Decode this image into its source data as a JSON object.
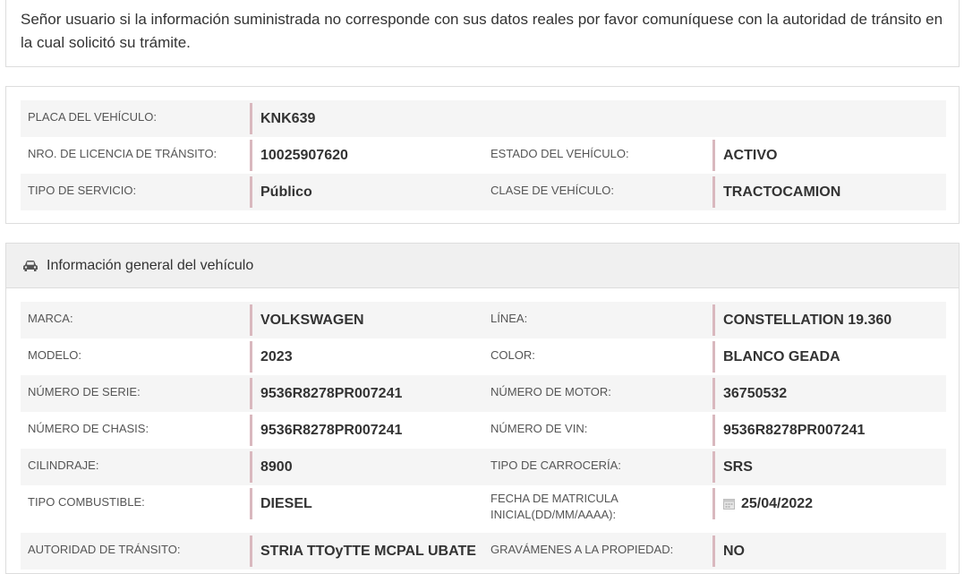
{
  "notice": "Señor usuario si la información suministrada no corresponde con sus datos reales por favor comuníquese con la autoridad de tránsito en la cual solicitó su trámite.",
  "summary": {
    "placa_label": "PLACA DEL VEHÍCULO:",
    "placa_value": "KNK639",
    "licencia_label": "NRO. DE LICENCIA DE TRÁNSITO:",
    "licencia_value": "10025907620",
    "estado_label": "ESTADO DEL VEHÍCULO:",
    "estado_value": "ACTIVO",
    "servicio_label": "TIPO DE SERVICIO:",
    "servicio_value": "Público",
    "clase_label": "CLASE DE VEHÍCULO:",
    "clase_value": "TRACTOCAMION"
  },
  "general": {
    "title": "Información general del vehículo",
    "icon": "car-icon",
    "rows": [
      {
        "l1": "MARCA:",
        "v1": "VOLKSWAGEN",
        "l2": "LÍNEA:",
        "v2": "CONSTELLATION 19.360"
      },
      {
        "l1": "MODELO:",
        "v1": "2023",
        "l2": "COLOR:",
        "v2": "BLANCO GEADA"
      },
      {
        "l1": "NÚMERO DE SERIE:",
        "v1": "9536R8278PR007241",
        "l2": "NÚMERO DE MOTOR:",
        "v2": "36750532"
      },
      {
        "l1": "NÚMERO DE CHASIS:",
        "v1": "9536R8278PR007241",
        "l2": "NÚMERO DE VIN:",
        "v2": "9536R8278PR007241"
      },
      {
        "l1": "CILINDRAJE:",
        "v1": "8900",
        "l2": "TIPO DE CARROCERÍA:",
        "v2": "SRS"
      },
      {
        "l1": "TIPO COMBUSTIBLE:",
        "v1": "DIESEL",
        "l2": "FECHA DE MATRICULA INICIAL(DD/MM/AAAA):",
        "v2": "25/04/2022"
      },
      {
        "l1": "AUTORIDAD DE TRÁNSITO:",
        "v1": "STRIA TTOyTTE MCPAL UBATE",
        "l2": "GRAVÁMENES A LA PROPIEDAD:",
        "v2": "NO"
      }
    ]
  },
  "colors": {
    "accent_border": "#d9b8be",
    "row_shade": "#f5f5f5",
    "header_bg": "#f0f0f0"
  }
}
